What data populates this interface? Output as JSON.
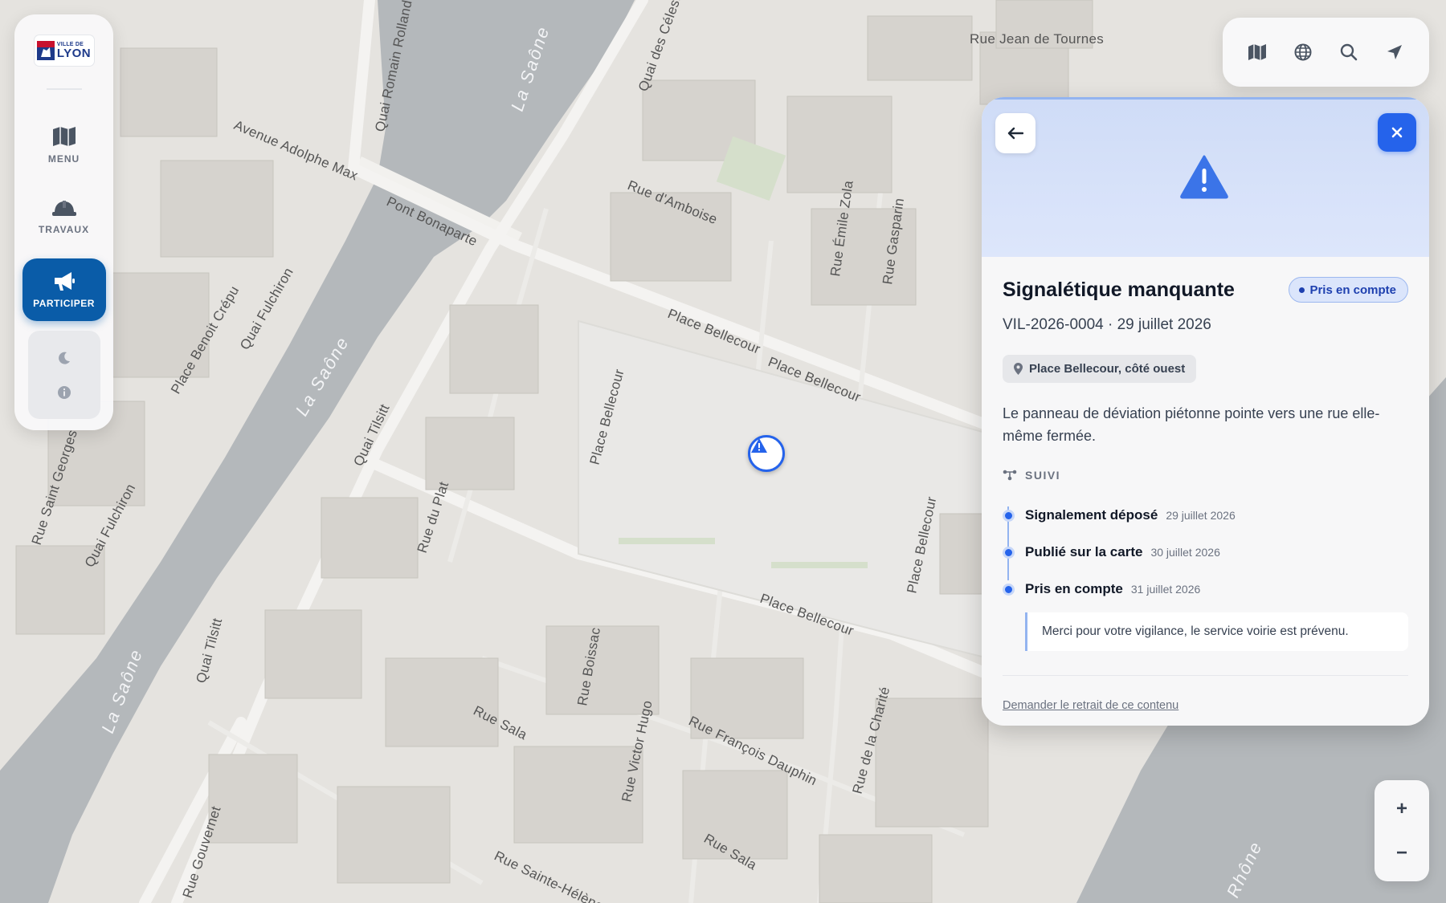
{
  "app": {
    "logo_small_text": "VILLE DE",
    "logo_big_text": "LYON"
  },
  "sidebar": {
    "items": [
      {
        "label": "MENU",
        "icon": "map-icon"
      },
      {
        "label": "TRAVAUX",
        "icon": "hard-hat-icon"
      },
      {
        "label": "PARTICIPER",
        "icon": "megaphone-icon",
        "active": true
      }
    ],
    "utilities": [
      {
        "icon": "moon-icon"
      },
      {
        "icon": "info-icon"
      }
    ]
  },
  "toolbar": {
    "buttons": [
      "map-layers-icon",
      "globe-icon",
      "search-icon",
      "locate-arrow-icon"
    ]
  },
  "map": {
    "street_labels": [
      "Avenue Adolphe Max",
      "Pont Bonaparte",
      "Rue d'Amboise",
      "Place Bellecour",
      "Place Bellecour",
      "Place Bellecour",
      "Place Bellecour",
      "Place Bellecour",
      "Quai Romain Rolland",
      "Quai des Célestins",
      "Rue Jean de Tournes",
      "Rue Émile Zola",
      "Rue Gasparin",
      "Quai Tilsitt",
      "Quai Tilsitt",
      "Quai Fulchiron",
      "Quai Fulchiron",
      "Rue Saint Georges",
      "Rue du Plat",
      "Rue Sala",
      "Rue Sala",
      "Rue Boissac",
      "Rue Victor Hugo",
      "Rue François Dauphin",
      "Rue de la Charité",
      "Rue Gouvernet",
      "Rue Sainte-Hélène",
      "Place Benoit Crépu"
    ],
    "river_labels": [
      "La Saône",
      "La Saône",
      "La Saône",
      "Rhône"
    ],
    "marker_icon": "warning-icon"
  },
  "panel": {
    "title": "Signalétique manquante",
    "status": "Pris en compte",
    "reference": "VIL-2026-0004 · 29 juillet 2026",
    "location": "Place Bellecour, côté ouest",
    "description": "Le panneau de déviation piétonne pointe vers une rue elle-même fermée.",
    "suivi_label": "SUIVI",
    "timeline": [
      {
        "label": "Signalement déposé",
        "date": "29 juillet 2026"
      },
      {
        "label": "Publié sur la carte",
        "date": "30 juillet 2026"
      },
      {
        "label": "Pris en compte",
        "date": "31 juillet 2026"
      }
    ],
    "note": "Merci pour votre vigilance, le service voirie est prévenu.",
    "remove_link": "Demander le retrait de ce contenu"
  },
  "zoom": {
    "in_label": "+",
    "out_label": "−"
  },
  "colors": {
    "accent": "#2563eb",
    "nav_active": "#0a5ca8",
    "river": "#b4b8bb",
    "map_land": "#e5e3df"
  }
}
